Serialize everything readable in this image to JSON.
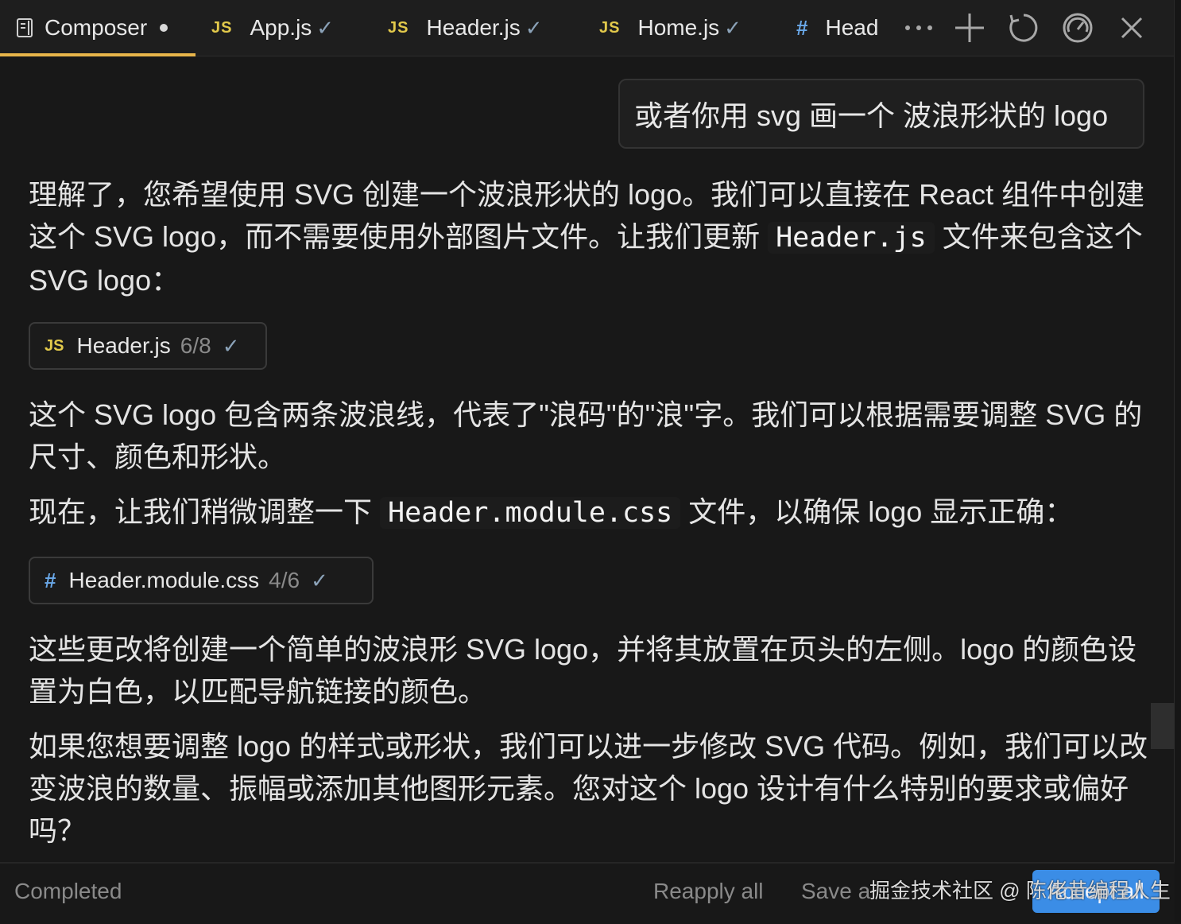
{
  "tabs": [
    {
      "label": "Composer",
      "type": "composer",
      "active": true
    },
    {
      "label": "App.js",
      "type": "js"
    },
    {
      "label": "Header.js",
      "type": "js"
    },
    {
      "label": "Home.js",
      "type": "js"
    },
    {
      "label": "Head",
      "type": "css"
    }
  ],
  "tab_icons": {
    "js": "JS",
    "css": "#",
    "check": "✓"
  },
  "actions": [
    "more-icon",
    "plus-icon",
    "history-icon",
    "gauge-icon",
    "close-icon"
  ],
  "user_message": "或者你用 svg 画一个 波浪形状的 logo",
  "p1": {
    "a": "理解了，您希望使用 SVG 创建一个波浪形状的 logo。我们可以直接在 React 组件中创建这个 SVG logo，而不需要使用外部图片文件。让我们更新 ",
    "code": "Header.js",
    "b": " 文件来包含这个 SVG logo："
  },
  "chip1": {
    "icon": "JS",
    "name": "Header.js",
    "count": "6/8",
    "check": "✓"
  },
  "p2": "这个 SVG logo 包含两条波浪线，代表了\"浪码\"的\"浪\"字。我们可以根据需要调整 SVG 的尺寸、颜色和形状。",
  "p3": {
    "a": "现在，让我们稍微调整一下 ",
    "code": "Header.module.css",
    "b": " 文件，以确保 logo 显示正确："
  },
  "chip2": {
    "icon": "#",
    "name": "Header.module.css",
    "count": "4/6",
    "check": "✓"
  },
  "p4": "这些更改将创建一个简单的波浪形 SVG logo，并将其放置在页头的左侧。logo 的颜色设置为白色，以匹配导航链接的颜色。",
  "p5": "如果您想要调整 logo 的样式或形状，我们可以进一步修改 SVG 代码。例如，我们可以改变波浪的数量、振幅或添加其他图形元素。您对这个 logo 设计有什么特别的要求或偏好吗？",
  "bottom": {
    "status": "Completed",
    "reapply": "Reapply all",
    "save": "Save a",
    "accept": "Accept all",
    "watermark": "掘金技术社区 @ 陈佬昔编程人生"
  },
  "colors": {
    "accent": "#e8b54a",
    "button": "#3b8de6",
    "js": "#e2c94b",
    "css": "#6aa8e8"
  }
}
